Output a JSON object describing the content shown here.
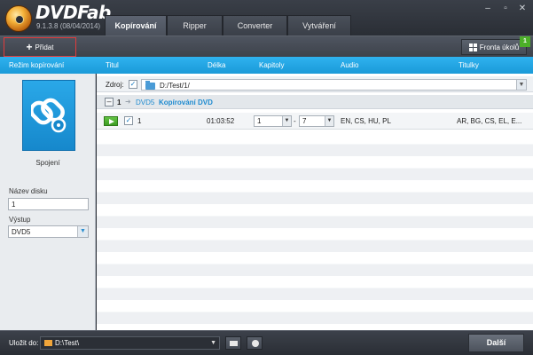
{
  "app": {
    "brand": "DVDFab",
    "version": "9.1.3.8 (08/04/2014)"
  },
  "tabs": [
    {
      "label": "Kopírování",
      "active": true
    },
    {
      "label": "Ripper",
      "active": false
    },
    {
      "label": "Converter",
      "active": false
    },
    {
      "label": "Vytváření",
      "active": false
    }
  ],
  "window_controls": [
    "minimize",
    "maximize",
    "close"
  ],
  "toolbar": {
    "add_label": "Přidat",
    "queue_label": "Fronta úkolů",
    "queue_count": "1"
  },
  "columns": {
    "mode": "Režim kopírování",
    "title": "Titul",
    "length": "Délka",
    "chapters": "Kapitoly",
    "audio": "Audio",
    "subtitles": "Titulky"
  },
  "left_panel": {
    "mode_name": "Spojení",
    "disc_name_label": "Název disku",
    "disc_name_value": "1",
    "output_label": "Výstup",
    "output_value": "DVD5"
  },
  "source": {
    "label": "Zdroj:",
    "path": "D:/Test/1/"
  },
  "group": {
    "number": "1",
    "type": "DVD5",
    "mode": "Kopírování DVD"
  },
  "titles": [
    {
      "index": "1",
      "length": "01:03:52",
      "chapter_from": "1",
      "chapter_sep": "-",
      "chapter_to": "7",
      "audio": "EN, CS, HU, PL",
      "subtitles": "AR, BG, CS, EL, E..."
    }
  ],
  "bottom": {
    "save_label": "Uložit do:",
    "save_path": "D:\\Test\\",
    "next_label": "Další"
  },
  "colors": {
    "accent": "#1fa3e2",
    "highlight_border": "#e23b3b",
    "badge": "#4caf28",
    "play": "#4aad2e"
  }
}
